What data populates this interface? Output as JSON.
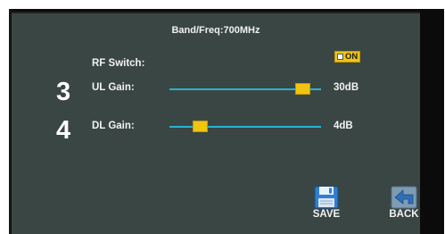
{
  "header": {
    "title": "Band/Freq:700MHz"
  },
  "rf_switch": {
    "label": "RF Switch:",
    "state": "ON"
  },
  "ul_gain": {
    "marker": "3",
    "label": "UL Gain:",
    "value": "30dB",
    "fill_fraction": 0.88
  },
  "dl_gain": {
    "marker": "4",
    "label": "DL Gain:",
    "value": "4dB",
    "fill_fraction": 0.2
  },
  "actions": {
    "save_label": "SAVE",
    "back_label": "BACK"
  },
  "colors": {
    "panel": "#3a4644",
    "slider_track": "#27b3cf",
    "slider_thumb": "#f1c40f",
    "text": "#f2f2f2"
  },
  "icons": {
    "save": "floppy-disk-icon",
    "back": "back-arrow-icon"
  }
}
